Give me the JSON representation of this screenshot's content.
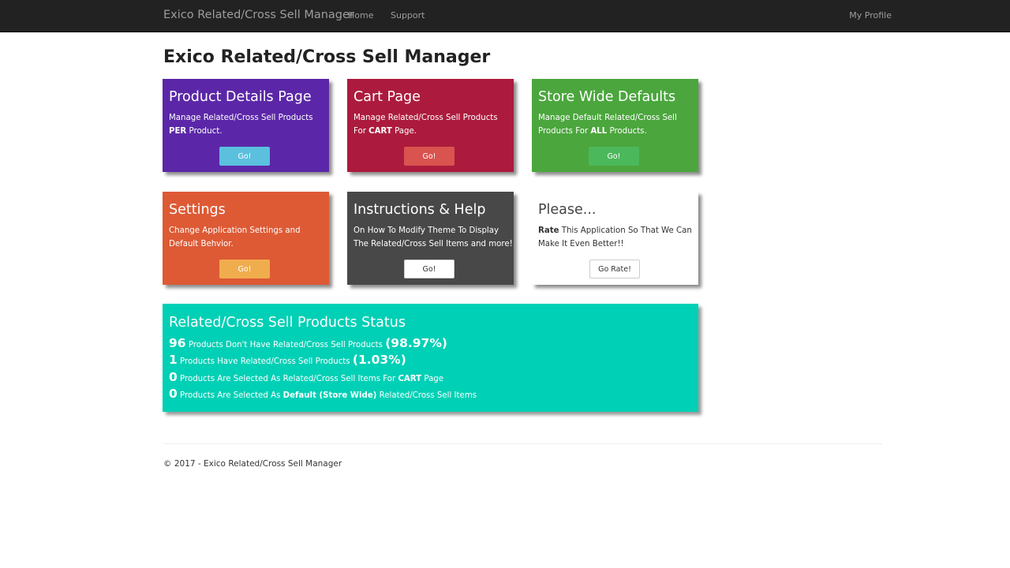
{
  "nav": {
    "brand": "Exico Related/Cross Sell Manager",
    "home": "Home",
    "support": "Support",
    "profile": "My Profile"
  },
  "page": {
    "title": "Exico Related/Cross Sell Manager"
  },
  "tiles": [
    {
      "title": "Product Details Page",
      "desc_line1": "Manage Related/Cross Sell Products",
      "desc_line2_bold": "PER",
      "desc_line2_rest": " Product.",
      "button": "Go!",
      "color": "#5b27a8"
    },
    {
      "title": "Cart Page",
      "desc_line1": "Manage Related/Cross Sell Products",
      "desc_line2_pre": "For ",
      "desc_line2_bold": "CART",
      "desc_line2_rest": " Page.",
      "button": "Go!",
      "color": "#ac1b3d"
    },
    {
      "title": "Store Wide Defaults",
      "desc_line1": "Manage Default Related/Cross Sell",
      "desc_line2_pre": "Products For ",
      "desc_line2_bold": "ALL",
      "desc_line2_rest": " Products.",
      "button": "Go!",
      "color": "#4ba63d"
    },
    {
      "title": "Settings",
      "desc_line1": "Change Application Settings and",
      "desc_line2": "Default Behvior.",
      "button": "Go!",
      "color": "#dd5a35"
    },
    {
      "title": "Instructions & Help",
      "desc_line1": "On How To Modify Theme To Display",
      "desc_line2": "The Related/Cross Sell Items and more!",
      "button": "Go!",
      "color": "#484848"
    },
    {
      "title": "Please...",
      "desc_line1_bold": "Rate",
      "desc_line1_rest": " This Application So That We Can",
      "desc_line2": "Make It Even Better!!",
      "button": "Go Rate!",
      "color": "#ffffff"
    }
  ],
  "status": {
    "title": "Related/Cross Sell Products Status",
    "color": "#00d0b5",
    "line1": {
      "count": "96",
      "text": " Products Don't Have Related/Cross Sell Products ",
      "pct": "(98.97%)"
    },
    "line2": {
      "count": "1",
      "text": " Products Have Related/Cross Sell Products ",
      "pct": "(1.03%)"
    },
    "line3": {
      "count": "0",
      "text": " Products Are Selected As Related/Cross Sell Items For ",
      "bold": "CART",
      "rest": " Page"
    },
    "line4": {
      "count": "0",
      "text": " Products Are Selected As ",
      "bold": "Default (Store Wide)",
      "rest": " Related/Cross Sell Items"
    }
  },
  "footer": {
    "text": "© 2017 - Exico Related/Cross Sell Manager"
  }
}
